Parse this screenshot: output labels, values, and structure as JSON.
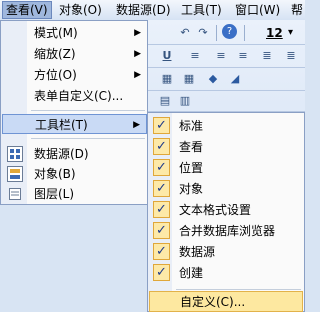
{
  "menubar": {
    "items": [
      {
        "label": "查看(V)",
        "active": true
      },
      {
        "label": "对象(O)",
        "active": false
      },
      {
        "label": "数据源(D)",
        "active": false
      },
      {
        "label": "工具(T)",
        "active": false
      },
      {
        "label": "窗口(W)",
        "active": false
      },
      {
        "label": "帮",
        "active": false
      }
    ]
  },
  "toolbar": {
    "font_size": "12",
    "font_size_arrow": "▾",
    "row1_icons": [
      "undo-icon",
      "redo-icon",
      "help-icon"
    ],
    "row2_icons": [
      "underline-icon",
      "align-left-icon",
      "align-center-icon",
      "align-right-icon",
      "justify-icon"
    ],
    "row3_icons": [
      "fill-color-icon",
      "line-color-icon"
    ]
  },
  "view_menu": {
    "items": [
      {
        "label": "模式(M)",
        "has_submenu": true,
        "arrow": "▶"
      },
      {
        "label": "缩放(Z)",
        "has_submenu": true,
        "arrow": "▶"
      },
      {
        "label": "方位(O)",
        "has_submenu": true,
        "arrow": "▶"
      },
      {
        "label": "表单自定义(C)...",
        "has_submenu": false
      },
      {
        "label": "工具栏(T)",
        "has_submenu": true,
        "arrow": "▶",
        "highlighted": true
      },
      {
        "label": "数据源(D)",
        "icon": "datasource-icon"
      },
      {
        "label": "对象(B)",
        "icon": "object-icon"
      },
      {
        "label": "图层(L)",
        "icon": "layer-icon"
      }
    ]
  },
  "toolbar_submenu": {
    "check_glyph": "✓",
    "items": [
      {
        "label": "标准",
        "checked": true
      },
      {
        "label": "查看",
        "checked": true
      },
      {
        "label": "位置",
        "checked": true
      },
      {
        "label": "对象",
        "checked": true
      },
      {
        "label": "文本格式设置",
        "checked": true
      },
      {
        "label": "合并数据库浏览器",
        "checked": true
      },
      {
        "label": "数据源",
        "checked": true
      },
      {
        "label": "创建",
        "checked": true
      }
    ],
    "customize": {
      "label": "自定义(C)...",
      "highlighted": true
    }
  },
  "colors": {
    "highlight": "#fde8a0",
    "menu_highlight": "#c9daf5",
    "check_border": "#e0a73a"
  }
}
